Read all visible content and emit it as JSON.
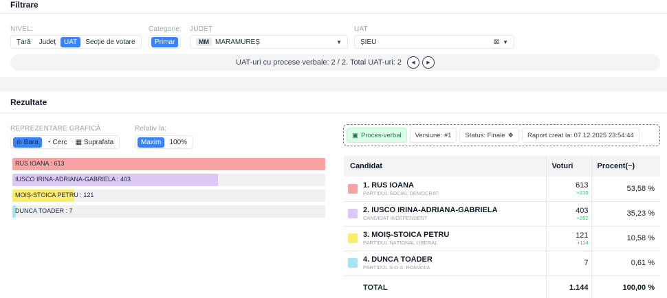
{
  "filters": {
    "title": "Filtrare",
    "nivel_label": "NIVEL:",
    "nivel_options": [
      "Țară",
      "Județ",
      "UAT",
      "Secție de votare"
    ],
    "nivel_active": 2,
    "categorie_label": "Categorie:",
    "categorie_value": "Primar",
    "judet_label": "JUDEȚ",
    "judet_code": "MM",
    "judet_value": "MARAMUREȘ",
    "uat_label": "UAT",
    "uat_value": "ȘIEU",
    "clear_icon": "⊠",
    "caret": "▼",
    "info_text": "UAT-uri cu procese verbale: 2 / 2. Total UAT-uri: 2",
    "prev": "◀",
    "next": "▶"
  },
  "results": {
    "title": "Rezultate",
    "repr_label": "REPREZENTARE GRAFICĂ",
    "repr_options": [
      {
        "icon": "bar-chart-icon",
        "glyph": "ılı",
        "label": "Bara"
      },
      {
        "icon": "pie-chart-icon",
        "glyph": "◔",
        "label": "Cerc"
      },
      {
        "icon": "area-chart-icon",
        "glyph": "▦",
        "label": "Suprafata"
      }
    ],
    "relativ_label": "Relativ la:",
    "relativ_options": [
      "Maxim",
      "100%"
    ],
    "pv_button": "Proces-verbal",
    "pv_icon": "▣",
    "versiune": "Versiune: #1",
    "status": "Status: Finale",
    "status_icon": "❖",
    "raport": "Raport creat la: 07.12.2025 23:54:44",
    "table_headers": [
      "Candidat",
      "Voturi",
      "Procent(~)"
    ],
    "candidates": [
      {
        "name": "1. RUS IOANA",
        "party": "PARTIDUL SOCIAL DEMOCRAT",
        "votes": "613",
        "delta": "+210",
        "pct": "53,58 %",
        "color": "#f8a3a3"
      },
      {
        "name": "2. IUSCO IRINA-ADRIANA-GABRIELA",
        "party": "CANDIDAT INDEPENDENT",
        "votes": "403",
        "delta": "+282",
        "pct": "35,23 %",
        "color": "#dcc8f5"
      },
      {
        "name": "3. MOIȘ-STOICA PETRU",
        "party": "PARTIDUL NAȚIONAL LIBERAL",
        "votes": "121",
        "delta": "+114",
        "pct": "10,58 %",
        "color": "#fbec6b"
      },
      {
        "name": "4. DUNCA TOADER",
        "party": "PARTIDUL S.O.S. ROMÂNIA",
        "votes": "7",
        "delta": "",
        "pct": "0,61 %",
        "color": "#a5e4f2"
      }
    ],
    "total_label": "TOTAL",
    "total_votes": "1.144",
    "total_pct": "100,00 %"
  },
  "chart_data": {
    "type": "bar",
    "categories": [
      "RUS IOANA",
      "IUSCO IRINA-ADRIANA-GABRIELA",
      "MOIȘ-STOICA PETRU",
      "DUNCA TOADER"
    ],
    "labels": [
      "RUS IOANA : 613",
      "IUSCO IRINA-ADRIANA-GABRIELA : 403",
      "MOIȘ-STOICA PETRU : 121",
      "DUNCA TOADER : 7"
    ],
    "values": [
      613,
      403,
      121,
      7
    ],
    "colors": [
      "#f8a3a3",
      "#dcc8f5",
      "#fbec6b",
      "#a5e4f2"
    ],
    "relative_to": "max"
  }
}
